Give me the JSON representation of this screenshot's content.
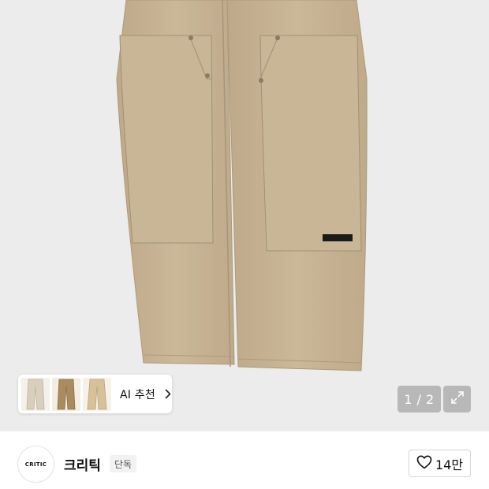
{
  "product": {
    "image_alt": "product-photo-beige-double-knee-pants"
  },
  "ai_recommend": {
    "label": "AI 추천",
    "thumbnails": [
      "light-beige-pants",
      "tan-cargo-pants",
      "beige-pants"
    ],
    "chevron_icon": "chevron-right-icon"
  },
  "pager": {
    "text": "1 / 2"
  },
  "expand": {
    "icon": "expand-icon"
  },
  "brand": {
    "logo_text": "CRITIC",
    "name": "크리틱",
    "badge": "단독"
  },
  "like": {
    "icon": "heart-icon",
    "count": "14만"
  },
  "colors": {
    "image_bg": "#ececec",
    "pants": "#c8b596",
    "overlay": "rgba(0,0,0,0.22)"
  }
}
